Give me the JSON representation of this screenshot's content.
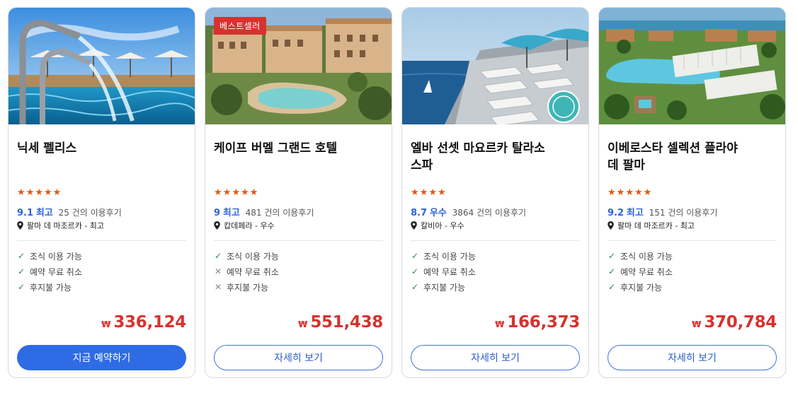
{
  "cards": [
    {
      "title_lines": [
        "닉세 펠리스",
        ""
      ],
      "badge": "",
      "stars": 5,
      "score": "9.1",
      "grade": "최고",
      "reviews": "25 건의 이용후기",
      "location": "팔마 데 마조르카 - 최고",
      "features": [
        {
          "label": "조식 이용 가능",
          "ok": true
        },
        {
          "label": "예약 무료 취소",
          "ok": true
        },
        {
          "label": "후지불 가능",
          "ok": true
        }
      ],
      "currency": "₩",
      "price": "336,124",
      "button": "지금 예약하기",
      "button_primary": true
    },
    {
      "title_lines": [
        "케이프 버멜 그랜드 호텔",
        ""
      ],
      "badge": "베스트셀러",
      "stars": 5,
      "score": "9",
      "grade": "최고",
      "reviews": "481 건의 이용후기",
      "location": "캅데페라 - 우수",
      "features": [
        {
          "label": "조식 이용 가능",
          "ok": true
        },
        {
          "label": "예약 무료 취소",
          "ok": false
        },
        {
          "label": "후지불 가능",
          "ok": false
        }
      ],
      "currency": "₩",
      "price": "551,438",
      "button": "자세히 보기",
      "button_primary": false
    },
    {
      "title_lines": [
        "엘바 선셋 마요르카 탈라소",
        "스파"
      ],
      "badge": "",
      "stars": 4,
      "score": "8.7",
      "grade": "우수",
      "reviews": "3864 건의 이용후기",
      "location": "칼비아 - 우수",
      "features": [
        {
          "label": "조식 이용 가능",
          "ok": true
        },
        {
          "label": "예약 무료 취소",
          "ok": true
        },
        {
          "label": "후지불 가능",
          "ok": true
        }
      ],
      "currency": "₩",
      "price": "166,373",
      "button": "자세히 보기",
      "button_primary": false
    },
    {
      "title_lines": [
        "이베로스타 셀렉션 플라야",
        "데 팔마"
      ],
      "badge": "",
      "stars": 5,
      "score": "9.2",
      "grade": "최고",
      "reviews": "151 건의 이용후기",
      "location": "팔마 데 마조르카 - 최고",
      "features": [
        {
          "label": "조식 이용 가능",
          "ok": true
        },
        {
          "label": "예약 무료 취소",
          "ok": true
        },
        {
          "label": "후지불 가능",
          "ok": true
        }
      ],
      "currency": "₩",
      "price": "370,784",
      "button": "자세히 보기",
      "button_primary": false
    }
  ],
  "colors": {
    "accent": "#2f6be4",
    "price": "#d7322f",
    "star": "#e05a12",
    "check": "#2e8b3d",
    "score": "#2d63d8"
  },
  "icons": {
    "star": "star-icon",
    "location": "location-pin-icon",
    "check": "check-icon",
    "cross": "cross-icon"
  }
}
